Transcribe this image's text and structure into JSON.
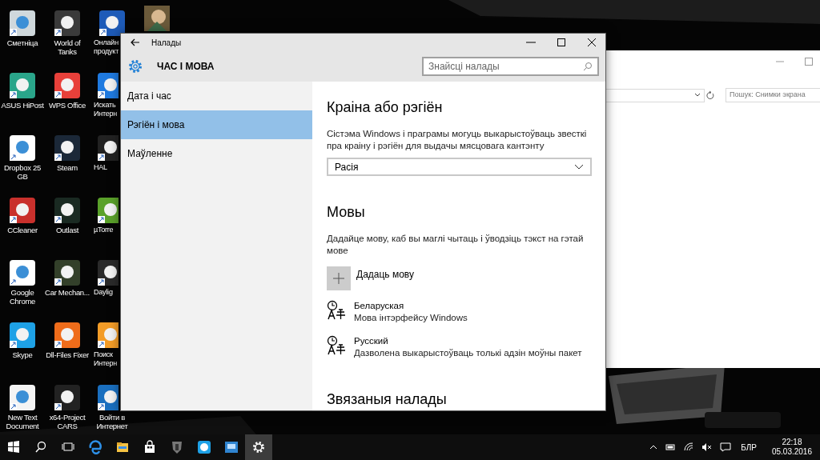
{
  "desktop_icons": [
    {
      "label": "Сметніца"
    },
    {
      "label": "World of Tanks"
    },
    {
      "label": "Онлайн продукт"
    },
    {
      "label": "ASUS HiPost"
    },
    {
      "label": "WPS Office"
    },
    {
      "label": "Искать Интерн"
    },
    {
      "label": "Dropbox 25 GB"
    },
    {
      "label": "Steam"
    },
    {
      "label": "HAL"
    },
    {
      "label": "CCleaner"
    },
    {
      "label": "Outlast"
    },
    {
      "label": "µTorre"
    },
    {
      "label": "Google Chrome"
    },
    {
      "label": "Car Mechan..."
    },
    {
      "label": "Daylig"
    },
    {
      "label": "Skype"
    },
    {
      "label": "Dll-Files Fixer"
    },
    {
      "label": "Поиск Интерн"
    },
    {
      "label": "New Text Document"
    },
    {
      "label": "x64-Project CARS"
    },
    {
      "label": "Войти в Интернет"
    }
  ],
  "explorer": {
    "search_placeholder": "Пошук: Снимки экрана"
  },
  "settings": {
    "window_title": "Налады",
    "section_title": "ЧАС І МОВА",
    "search_placeholder": "Знайсці налады",
    "nav": [
      {
        "label": "Дата і час",
        "selected": false
      },
      {
        "label": "Рэгіён і мова",
        "selected": true
      },
      {
        "label": "Маўленне",
        "selected": false
      }
    ],
    "region": {
      "heading": "Краіна або рэгіён",
      "description": "Сістэма Windows і праграмы могуць выкарыстоўваць звесткі пра краіну і рэгіён для выдачы мясцовага кантэнту",
      "value": "Расія"
    },
    "languages": {
      "heading": "Мовы",
      "description": "Дадайце мову, каб вы маглі чытаць і ўводзіць тэкст на гэтай мове",
      "add_label": "Дадаць мову",
      "items": [
        {
          "name": "Беларуская",
          "note": "Мова інтэрфейсу Windows"
        },
        {
          "name": "Русский",
          "note": "Дазволена выкарыстоўваць толькі адзін моўны пакет"
        }
      ]
    },
    "related_heading": "Звязаныя налады"
  },
  "taskbar": {
    "buttons": [
      {
        "kind": "start",
        "selected": false
      },
      {
        "kind": "search",
        "selected": false
      },
      {
        "kind": "taskview",
        "selected": false
      },
      {
        "kind": "edge",
        "selected": false
      },
      {
        "kind": "explorer",
        "selected": false
      },
      {
        "kind": "store",
        "selected": false
      },
      {
        "kind": "tanks",
        "selected": false
      },
      {
        "kind": "skype",
        "selected": false
      },
      {
        "kind": "app",
        "selected": false
      },
      {
        "kind": "settings",
        "selected": true
      }
    ],
    "language": "БЛР",
    "time": "22:18",
    "date": "05.03.2016"
  }
}
